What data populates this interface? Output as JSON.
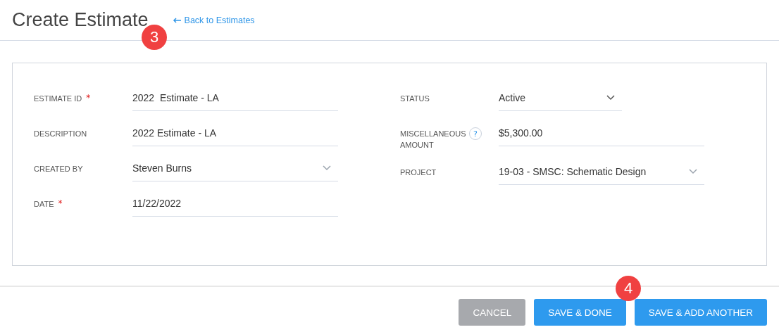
{
  "header": {
    "title": "Create Estimate",
    "back_link": "Back to Estimates"
  },
  "form": {
    "left": [
      {
        "label": "ESTIMATE ID",
        "required_mark": "*",
        "kind": "text",
        "value": "2022  Estimate - LA"
      },
      {
        "label": "DESCRIPTION",
        "kind": "text",
        "value": "2022 Estimate - LA"
      },
      {
        "label": "CREATED BY",
        "kind": "select",
        "value": "Steven Burns"
      },
      {
        "label": "DATE",
        "required_mark": "*",
        "kind": "text",
        "value": "11/22/2022"
      }
    ],
    "right": [
      {
        "label": "STATUS",
        "kind": "select",
        "value": "Active",
        "short": true
      },
      {
        "label": "MISCELLANEOUS AMOUNT",
        "help": "?",
        "kind": "text",
        "value": "$5,300.00"
      },
      {
        "label": "PROJECT",
        "kind": "select",
        "value": "19-03 - SMSC: Schematic Design"
      }
    ]
  },
  "buttons": [
    {
      "label": "CANCEL",
      "kind": "secondary"
    },
    {
      "label": "SAVE & DONE",
      "kind": "primary"
    },
    {
      "label": "SAVE & ADD ANOTHER",
      "kind": "primary"
    }
  ],
  "callouts": [
    "3",
    "4"
  ]
}
